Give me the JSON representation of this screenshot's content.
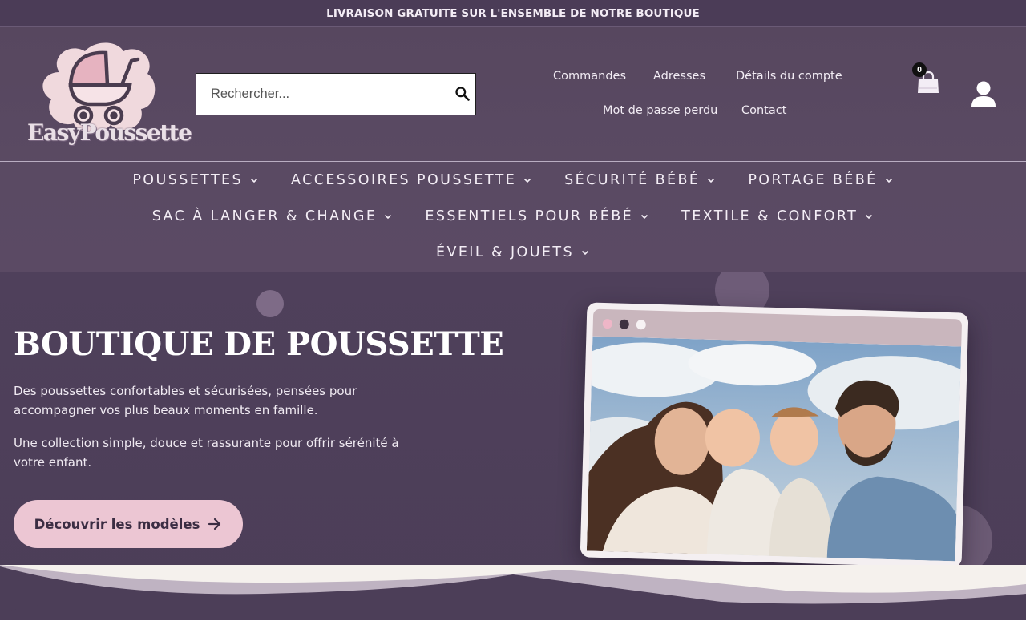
{
  "announcement": "LIVRAISON GRATUITE SUR L'ENSEMBLE DE NOTRE BOUTIQUE",
  "logo": {
    "brand": "EasyPoussette"
  },
  "search": {
    "placeholder": "Rechercher..."
  },
  "account_nav": {
    "orders": "Commandes",
    "addresses": "Adresses",
    "account_details": "Détails du compte",
    "lost_password": "Mot de passe perdu",
    "contact": "Contact"
  },
  "cart": {
    "count": "0"
  },
  "icons": {
    "search": "search-icon",
    "cart": "shopping-bag-icon",
    "user": "user-icon",
    "chevron": "chevron-down-icon",
    "arrow": "arrow-right-icon"
  },
  "menu": [
    {
      "label": "POUSSETTES"
    },
    {
      "label": "ACCESSOIRES POUSSETTE"
    },
    {
      "label": "SÉCURITÉ BÉBÉ"
    },
    {
      "label": "PORTAGE BÉBÉ"
    },
    {
      "label": "SAC À LANGER & CHANGE"
    },
    {
      "label": "ESSENTIELS POUR BÉBÉ"
    },
    {
      "label": "TEXTILE & CONFORT"
    },
    {
      "label": "ÉVEIL & JOUETS"
    }
  ],
  "hero": {
    "title": "BOUTIQUE DE POUSSETTE",
    "paragraph1": "Des poussettes confortables et sécurisées, pensées pour accompagner vos plus beaux moments en famille.",
    "paragraph2": "Une collection simple, douce et rassurante pour offrir sérénité à votre enfant.",
    "cta": "Découvrir les modèles"
  },
  "colors": {
    "header_bg": "#57475f",
    "hero_bg": "#4c3e58",
    "cta_bg": "#ecc6d3",
    "frame_bar": "#c9b6bd"
  }
}
